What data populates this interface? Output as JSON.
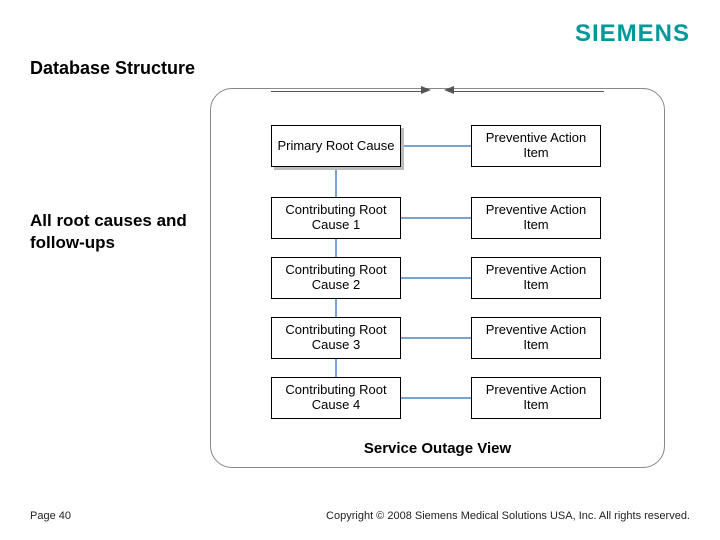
{
  "logo": "SIEMENS",
  "title": "Database Structure",
  "subtitle": "All root causes and follow-ups",
  "diagram": {
    "primary": "Primary Root Cause",
    "contrib": [
      "Contributing Root Cause 1",
      "Contributing Root Cause 2",
      "Contributing Root Cause 3",
      "Contributing Root Cause 4"
    ],
    "action": "Preventive Action Item",
    "caption": "Service Outage View"
  },
  "footer": {
    "page": "Page 40",
    "copyright": "Copyright © 2008 Siemens Medical Solutions USA, Inc. All rights reserved."
  }
}
